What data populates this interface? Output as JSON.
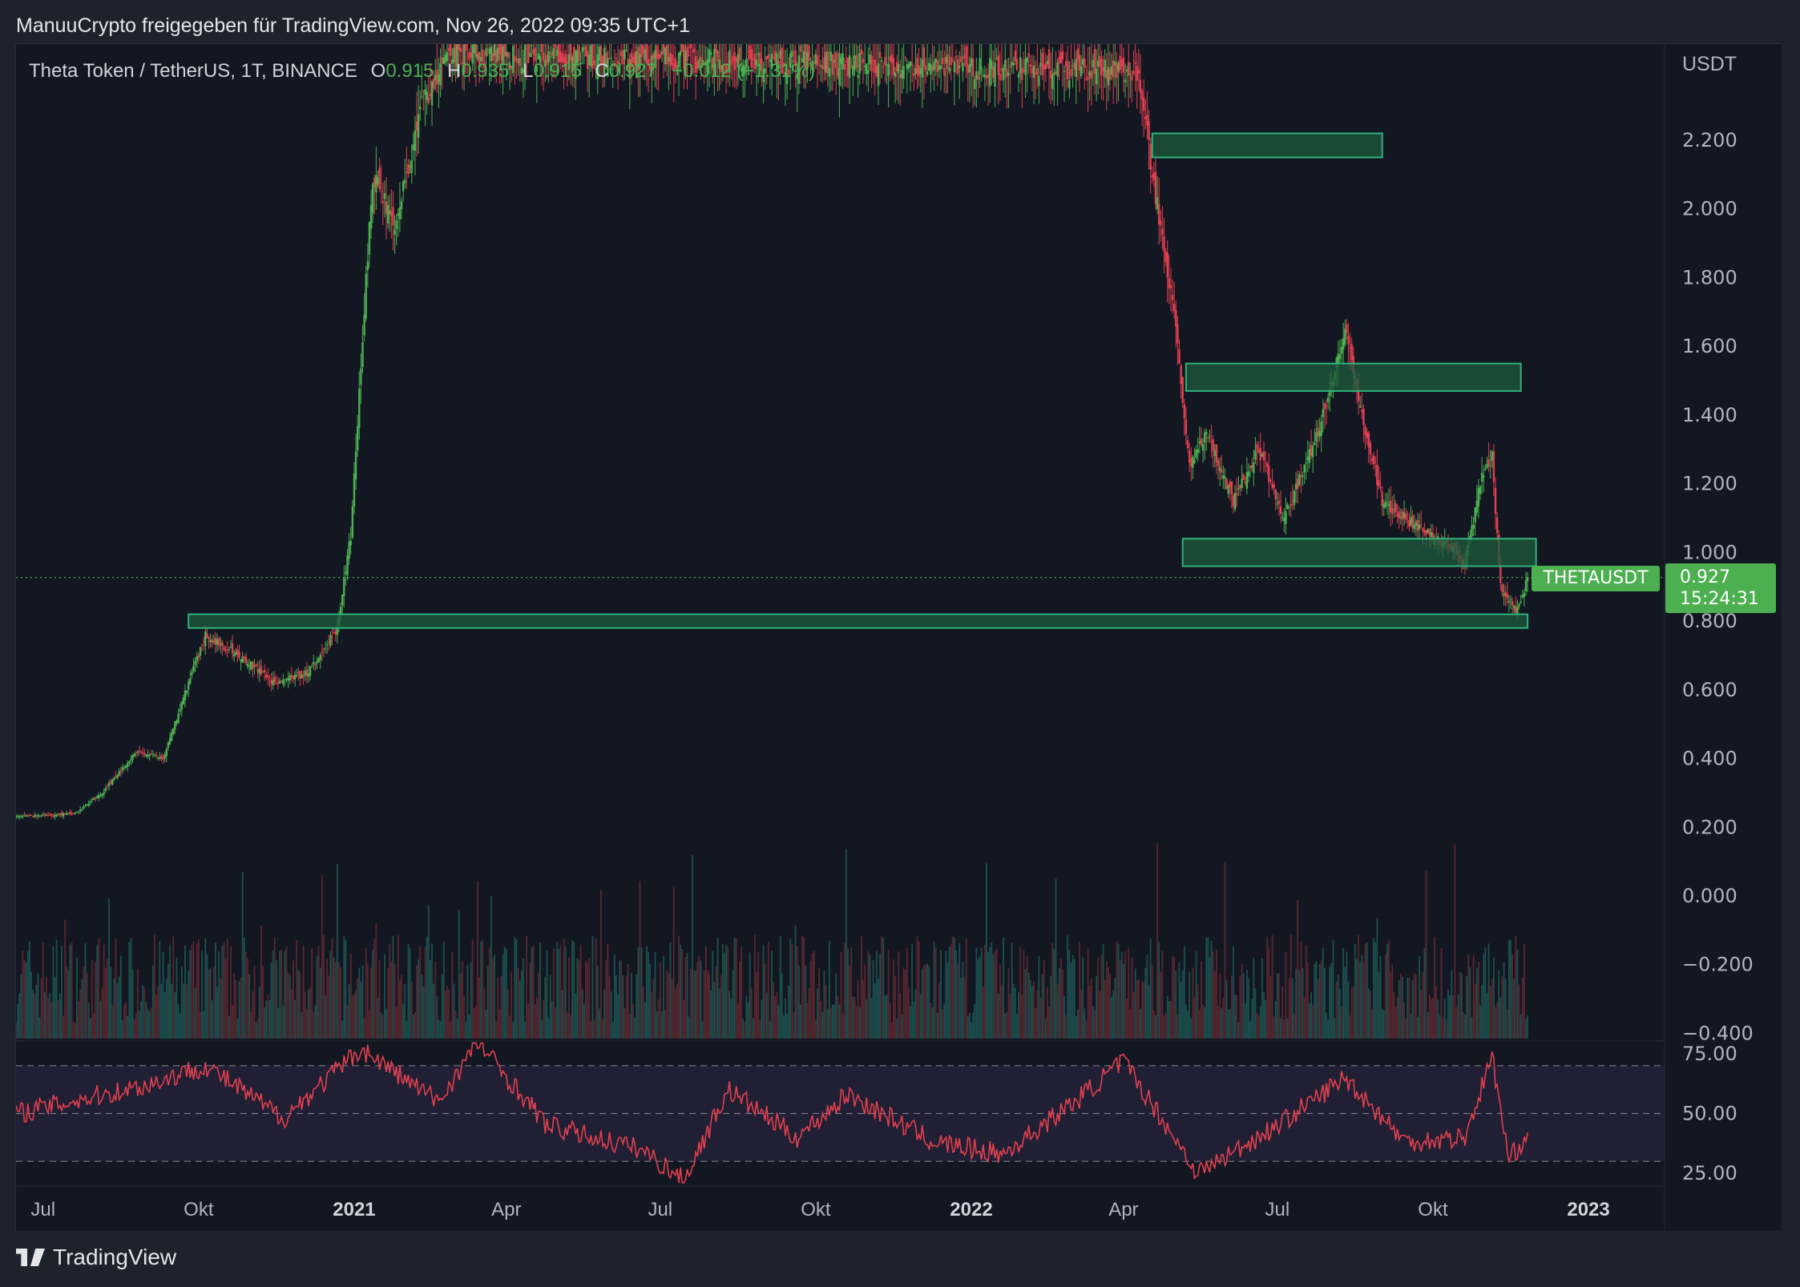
{
  "caption": "ManuuCrypto freigegeben für TradingView.com, Nov 26, 2022 09:35 UTC+1",
  "legend": {
    "symbol": "Theta Token / TetherUS, 1T, BINANCE",
    "o_label": "O",
    "o_value": "0.915",
    "h_label": "H",
    "h_value": "0.935",
    "l_label": "L",
    "l_value": "0.915",
    "c_label": "C",
    "c_value": "0.927",
    "change": "+0.012 (+1.31%)"
  },
  "currency_label": "USDT",
  "symbol_tag": "THETAUSDT",
  "price_tag": {
    "price": "0.927",
    "countdown": "15:24:31"
  },
  "footer_brand": "TradingView",
  "colors": {
    "background": "#131722",
    "frame": "#1e222d",
    "up": "#4caf50",
    "down": "#e0404f",
    "zone_fill": "#1e5b3c",
    "zone_border": "#2fb37a",
    "rsi_line": "#e0404f",
    "rsi_band": "#2a2540"
  },
  "chart_data": [
    {
      "type": "candlestick",
      "title": "Theta Token / TetherUS, 1T, BINANCE",
      "x_range": [
        "2020-06-15",
        "2023-02-15"
      ],
      "x_ticks": [
        {
          "date": "2020-07-01",
          "label": "Jul",
          "bold": false
        },
        {
          "date": "2020-10-01",
          "label": "Okt",
          "bold": false
        },
        {
          "date": "2021-01-01",
          "label": "2021",
          "bold": true
        },
        {
          "date": "2021-04-01",
          "label": "Apr",
          "bold": false
        },
        {
          "date": "2021-07-01",
          "label": "Jul",
          "bold": false
        },
        {
          "date": "2021-10-01",
          "label": "Okt",
          "bold": false
        },
        {
          "date": "2022-01-01",
          "label": "2022",
          "bold": true
        },
        {
          "date": "2022-04-01",
          "label": "Apr",
          "bold": false
        },
        {
          "date": "2022-07-01",
          "label": "Jul",
          "bold": false
        },
        {
          "date": "2022-10-01",
          "label": "Okt",
          "bold": false
        },
        {
          "date": "2023-01-01",
          "label": "2023",
          "bold": true
        }
      ],
      "y_range": [
        -0.42,
        2.48
      ],
      "y_ticks": [
        "2.200",
        "2.000",
        "1.800",
        "1.600",
        "1.400",
        "1.200",
        "1.000",
        "0.800",
        "0.600",
        "0.400",
        "0.200",
        "0.000",
        "−0.200",
        "−0.400"
      ],
      "y_tick_values": [
        2.2,
        2.0,
        1.8,
        1.6,
        1.4,
        1.2,
        1.0,
        0.8,
        0.6,
        0.4,
        0.2,
        0.0,
        -0.2,
        -0.4
      ],
      "last_price": 0.927,
      "price_path": [
        {
          "date": "2020-06-15",
          "close": 0.23
        },
        {
          "date": "2020-07-20",
          "close": 0.24
        },
        {
          "date": "2020-08-05",
          "close": 0.3
        },
        {
          "date": "2020-08-25",
          "close": 0.42
        },
        {
          "date": "2020-09-10",
          "close": 0.4
        },
        {
          "date": "2020-09-25",
          "close": 0.62
        },
        {
          "date": "2020-10-05",
          "close": 0.76
        },
        {
          "date": "2020-10-25",
          "close": 0.7
        },
        {
          "date": "2020-11-15",
          "close": 0.62
        },
        {
          "date": "2020-12-05",
          "close": 0.65
        },
        {
          "date": "2020-12-22",
          "close": 0.78
        },
        {
          "date": "2020-12-30",
          "close": 1.05
        },
        {
          "date": "2021-01-05",
          "close": 1.55
        },
        {
          "date": "2021-01-12",
          "close": 2.1
        },
        {
          "date": "2021-01-25",
          "close": 1.95
        },
        {
          "date": "2021-02-10",
          "close": 2.3
        },
        {
          "date": "2021-02-25",
          "close": 2.45
        },
        {
          "date": "2022-04-10",
          "close": 2.4
        },
        {
          "date": "2022-04-18",
          "close": 2.1
        },
        {
          "date": "2022-05-01",
          "close": 1.7
        },
        {
          "date": "2022-05-10",
          "close": 1.25
        },
        {
          "date": "2022-05-20",
          "close": 1.35
        },
        {
          "date": "2022-06-05",
          "close": 1.15
        },
        {
          "date": "2022-06-20",
          "close": 1.3
        },
        {
          "date": "2022-07-05",
          "close": 1.1
        },
        {
          "date": "2022-07-25",
          "close": 1.35
        },
        {
          "date": "2022-08-10",
          "close": 1.65
        },
        {
          "date": "2022-08-20",
          "close": 1.4
        },
        {
          "date": "2022-09-01",
          "close": 1.15
        },
        {
          "date": "2022-09-20",
          "close": 1.08
        },
        {
          "date": "2022-10-10",
          "close": 1.02
        },
        {
          "date": "2022-10-20",
          "close": 0.97
        },
        {
          "date": "2022-10-30",
          "close": 1.22
        },
        {
          "date": "2022-11-05",
          "close": 1.28
        },
        {
          "date": "2022-11-10",
          "close": 0.9
        },
        {
          "date": "2022-11-20",
          "close": 0.83
        },
        {
          "date": "2022-11-26",
          "close": 0.927
        }
      ],
      "zones": [
        {
          "start": "2022-04-18",
          "end": "2022-09-01",
          "low": 2.15,
          "high": 2.22
        },
        {
          "start": "2022-05-08",
          "end": "2022-11-22",
          "low": 1.47,
          "high": 1.55
        },
        {
          "start": "2022-05-06",
          "end": "2022-12-01",
          "low": 0.96,
          "high": 1.04
        },
        {
          "start": "2020-09-25",
          "end": "2022-11-26",
          "low": 0.78,
          "high": 0.82
        }
      ]
    },
    {
      "type": "area",
      "title": "RSI",
      "y_range": [
        20,
        80
      ],
      "y_ticks": [
        "75.00",
        "50.00",
        "25.00"
      ],
      "y_tick_values": [
        75,
        50,
        25
      ],
      "band": [
        30,
        70
      ],
      "path": [
        {
          "date": "2020-06-15",
          "rsi": 50
        },
        {
          "date": "2020-09-01",
          "rsi": 62
        },
        {
          "date": "2020-10-05",
          "rsi": 70
        },
        {
          "date": "2020-11-20",
          "rsi": 48
        },
        {
          "date": "2021-01-05",
          "rsi": 77
        },
        {
          "date": "2021-02-20",
          "rsi": 55
        },
        {
          "date": "2021-03-15",
          "rsi": 80
        },
        {
          "date": "2021-04-25",
          "rsi": 45
        },
        {
          "date": "2021-06-20",
          "rsi": 35
        },
        {
          "date": "2021-07-15",
          "rsi": 22
        },
        {
          "date": "2021-08-10",
          "rsi": 60
        },
        {
          "date": "2021-09-20",
          "rsi": 40
        },
        {
          "date": "2021-10-20",
          "rsi": 58
        },
        {
          "date": "2021-12-10",
          "rsi": 38
        },
        {
          "date": "2022-01-20",
          "rsi": 33
        },
        {
          "date": "2022-03-05",
          "rsi": 56
        },
        {
          "date": "2022-04-01",
          "rsi": 72
        },
        {
          "date": "2022-05-15",
          "rsi": 25
        },
        {
          "date": "2022-07-01",
          "rsi": 45
        },
        {
          "date": "2022-08-10",
          "rsi": 65
        },
        {
          "date": "2022-09-15",
          "rsi": 38
        },
        {
          "date": "2022-10-20",
          "rsi": 40
        },
        {
          "date": "2022-11-05",
          "rsi": 74
        },
        {
          "date": "2022-11-15",
          "rsi": 30
        },
        {
          "date": "2022-11-26",
          "rsi": 42
        }
      ]
    }
  ]
}
